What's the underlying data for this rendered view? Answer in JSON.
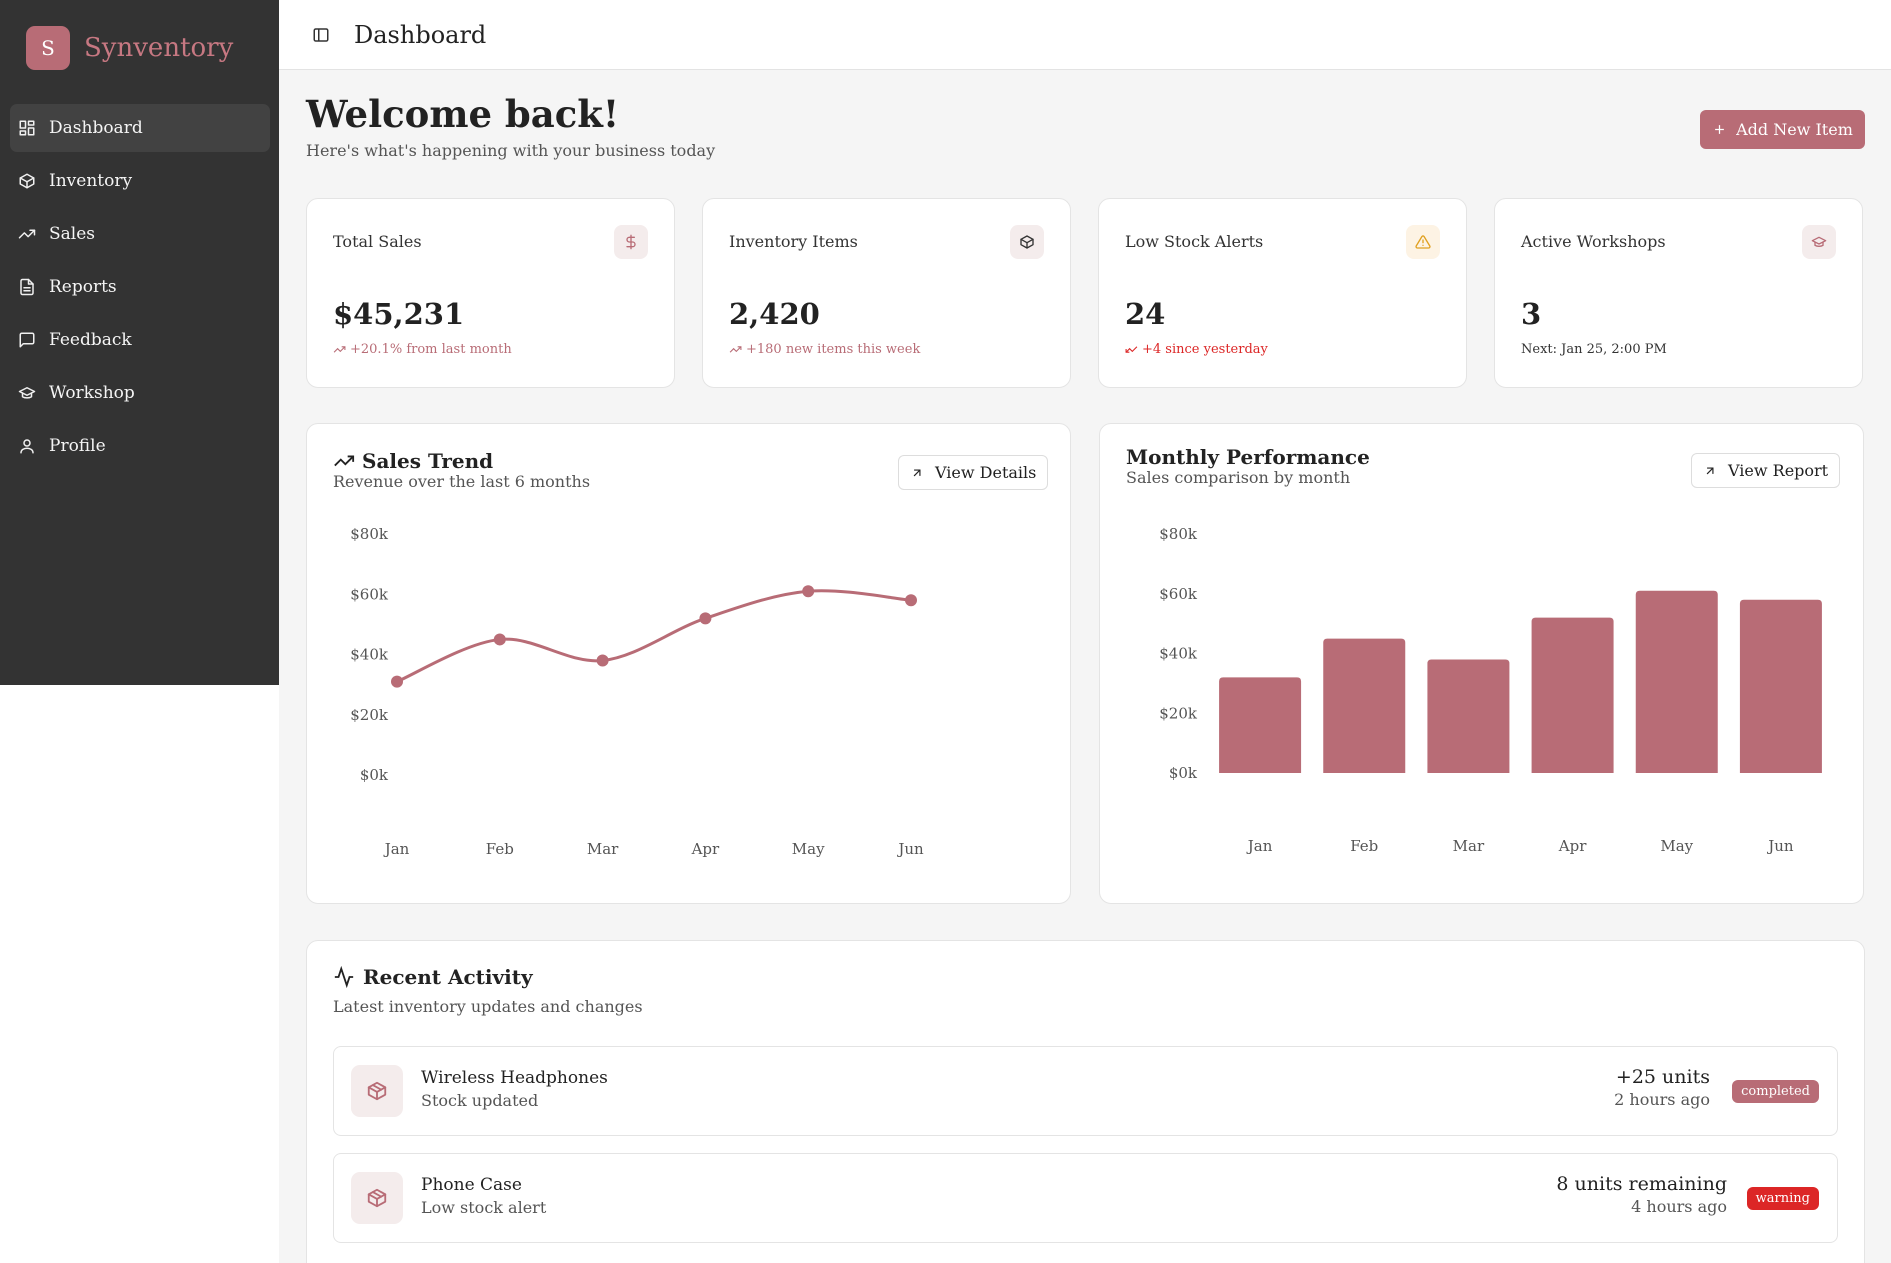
{
  "brand": {
    "logo_letter": "S",
    "name": "Synventory"
  },
  "nav": [
    {
      "label": "Dashboard",
      "icon": "grid-icon",
      "active": true
    },
    {
      "label": "Inventory",
      "icon": "box-icon"
    },
    {
      "label": "Sales",
      "icon": "trending-up-icon"
    },
    {
      "label": "Reports",
      "icon": "file-text-icon"
    },
    {
      "label": "Feedback",
      "icon": "message-square-icon"
    },
    {
      "label": "Workshop",
      "icon": "graduation-cap-icon"
    },
    {
      "label": "Profile",
      "icon": "user-icon"
    }
  ],
  "topbar": {
    "title": "Dashboard",
    "toggle_icon": "sidebar-toggle-icon"
  },
  "welcome": {
    "heading": "Welcome back!",
    "subheading": "Here's what's happening with your business today",
    "add_button": "Add New Item"
  },
  "stats": [
    {
      "label": "Total Sales",
      "value": "$45,231",
      "sub": "+20.1% from last month",
      "icon": "dollar-icon",
      "sub_color": "#b86c76",
      "icon_color": "#b86c76"
    },
    {
      "label": "Inventory Items",
      "value": "2,420",
      "sub": "+180 new items this week",
      "icon": "box-icon",
      "sub_color": "#b86c76",
      "icon_color": "#333333"
    },
    {
      "label": "Low Stock Alerts",
      "value": "24",
      "sub": "+4 since yesterday",
      "icon": "alert-triangle-icon",
      "sub_color": "#dc2626",
      "icon_color": "#e0a020"
    },
    {
      "label": "Active Workshops",
      "value": "3",
      "sub": "Next: Jan 25, 2:00 PM",
      "icon": "graduation-cap-icon",
      "sub_color": "#333333",
      "icon_color": "#b86c76"
    }
  ],
  "sales_trend": {
    "title": "Sales Trend",
    "subtitle": "Revenue over the last 6 months",
    "button": "View Details"
  },
  "monthly_performance": {
    "title": "Monthly Performance",
    "subtitle": "Sales comparison by month",
    "button": "View Report"
  },
  "chart_data": [
    {
      "type": "line",
      "title": "Sales Trend",
      "categories": [
        "Jan",
        "Feb",
        "Mar",
        "Apr",
        "May",
        "Jun"
      ],
      "values": [
        31000,
        45000,
        38000,
        52000,
        61000,
        58000
      ],
      "y_ticks": [
        "$0k",
        "$20k",
        "$40k",
        "$60k",
        "$80k"
      ],
      "ylim": [
        0,
        80000
      ],
      "color": "#b86c76"
    },
    {
      "type": "bar",
      "title": "Monthly Performance",
      "categories": [
        "Jan",
        "Feb",
        "Mar",
        "Apr",
        "May",
        "Jun"
      ],
      "values": [
        32000,
        45000,
        38000,
        52000,
        61000,
        58000
      ],
      "y_ticks": [
        "$0k",
        "$20k",
        "$40k",
        "$60k",
        "$80k"
      ],
      "ylim": [
        0,
        80000
      ],
      "color": "#b86c76"
    }
  ],
  "activity": {
    "title": "Recent Activity",
    "subtitle": "Latest inventory updates and changes",
    "items": [
      {
        "name": "Wireless Headphones",
        "desc": "Stock updated",
        "qty": "+25 units",
        "time": "2 hours ago",
        "status": "completed",
        "status_color": "#b86c76"
      },
      {
        "name": "Phone Case",
        "desc": "Low stock alert",
        "qty": "8 units remaining",
        "time": "4 hours ago",
        "status": "warning",
        "status_color": "#dc2626"
      }
    ]
  }
}
